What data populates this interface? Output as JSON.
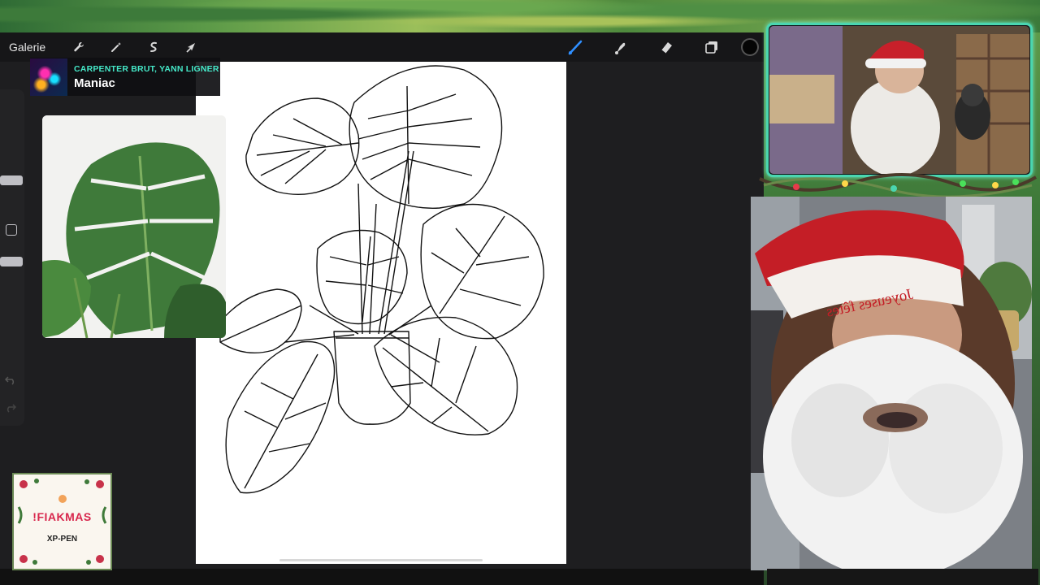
{
  "toolbar": {
    "gallery_label": "Galerie",
    "left_tools": [
      "wrench-icon",
      "magic-wand-icon",
      "selection-icon",
      "transform-arrow-icon"
    ],
    "right_tools": [
      "brush-icon",
      "smudge-icon",
      "eraser-icon",
      "layers-icon"
    ],
    "active_tool": "brush-icon",
    "active_color": "#050505",
    "accent_color": "#2f8fff"
  },
  "now_playing": {
    "artist": "CARPENTER BRUT, YANN LIGNER",
    "title": "Maniac"
  },
  "hat_text": "Joyeuses fêtes",
  "badge": {
    "title": "!FIAKMAS",
    "sponsor": "XP-PEN"
  },
  "colors": {
    "overlay_frame": "#4ad6b0",
    "artist_text": "#45e8c8",
    "badge_title": "#d8264c"
  }
}
